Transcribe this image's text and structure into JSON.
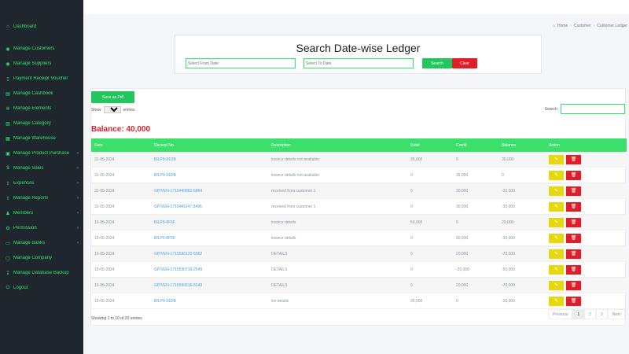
{
  "sidebar": {
    "items": [
      {
        "label": "Dashboard",
        "icon": "⌂",
        "chevron": ""
      },
      {
        "label": "Manage Customers",
        "icon": "◉",
        "chevron": ""
      },
      {
        "label": "Manage Suppliers",
        "icon": "◉",
        "chevron": ""
      },
      {
        "label": "Payment Receipt Voucher",
        "icon": "▯",
        "chevron": ""
      },
      {
        "label": "Manage Cashbook",
        "icon": "▤",
        "chevron": ""
      },
      {
        "label": "Manage Elements",
        "icon": "✲",
        "chevron": ""
      },
      {
        "label": "Manage Category",
        "icon": "▥",
        "chevron": ""
      },
      {
        "label": "Manage Warehouse",
        "icon": "▦",
        "chevron": ""
      },
      {
        "label": "Manage Product Purchase",
        "icon": "▣",
        "chevron": "‹"
      },
      {
        "label": "Manage Sales",
        "icon": "$",
        "chevron": "‹"
      },
      {
        "label": "Expences",
        "icon": "⇪",
        "chevron": "‹"
      },
      {
        "label": "Manage Reports",
        "icon": "⇪",
        "chevron": "‹"
      },
      {
        "label": "Members",
        "icon": "♟",
        "chevron": "‹"
      },
      {
        "label": "Permission",
        "icon": "⚙",
        "chevron": "‹"
      },
      {
        "label": "Manage Banks",
        "icon": "▭",
        "chevron": "‹"
      },
      {
        "label": "Manage Company",
        "icon": "▢",
        "chevron": ""
      },
      {
        "label": "Manage Database Backup",
        "icon": "↧",
        "chevron": ""
      },
      {
        "label": "Logout",
        "icon": "⏻",
        "chevron": ""
      }
    ]
  },
  "breadcrumb": {
    "home": "Home",
    "customer": "Customer",
    "current": "Customer Ledger"
  },
  "search": {
    "title": "Search Date-wise Ledger",
    "from_placeholder": "Select From Date",
    "to_placeholder": "Select To Date",
    "search_label": "Search",
    "clear_label": "Clear"
  },
  "ledger": {
    "save_pdf_label": "Save as Pdf",
    "show_label": "Show",
    "entries_value": "10",
    "entries_label": "entries",
    "search_label": "Search:",
    "balance": "Balance: 40,000",
    "columns": [
      "Date",
      "Receipt No.",
      "Description",
      "Debit",
      "Credit",
      "Balance",
      "Action"
    ],
    "rows": [
      {
        "date": "31-05-2024",
        "receipt": "BILP9-91DB",
        "desc": "invoice details not available",
        "debit": "35,000",
        "credit": "0",
        "balance": "35,000"
      },
      {
        "date": "31-05-2024",
        "receipt": "BILP9-91DB",
        "desc": "invoice details not available",
        "debit": "0",
        "credit": "35,000",
        "balance": "0"
      },
      {
        "date": "31-05-2024",
        "receipt": "GP/VEN-1716440882-6864",
        "desc": "received from customer 1",
        "debit": "0",
        "credit": "30,000",
        "balance": "-30,000"
      },
      {
        "date": "31-05-2024",
        "receipt": "GP/VEN-1716441147-3496",
        "desc": "received from customer 1",
        "debit": "0",
        "credit": "30,000",
        "balance": "-30,000"
      },
      {
        "date": "15-05-2024",
        "receipt": "BILP9-8F5F",
        "desc": "invoice details",
        "debit": "50,000",
        "credit": "0",
        "balance": "20,000"
      },
      {
        "date": "15-05-2024",
        "receipt": "BILP9-8F5F",
        "desc": "invoice details",
        "debit": "0",
        "credit": "50,000",
        "balance": "-30,000"
      },
      {
        "date": "15-05-2024",
        "receipt": "GP/VEN-1715596125-5562",
        "desc": "DETAILS",
        "debit": "0",
        "credit": "20,000",
        "balance": "-70,000"
      },
      {
        "date": "15-05-2024",
        "receipt": "GP/VEN-1715590716-2549",
        "desc": "DETAILS",
        "debit": "0",
        "credit": "-20,000",
        "balance": "-50,000"
      },
      {
        "date": "15-05-2024",
        "receipt": "GP/VEN-1715590616-5649",
        "desc": "DETAILS",
        "debit": "0",
        "credit": "20,000",
        "balance": "-70,000"
      },
      {
        "date": "15-05-2024",
        "receipt": "BILP9-91DB",
        "desc": "inv details",
        "debit": "35,000",
        "credit": "0",
        "balance": "-35,000"
      }
    ],
    "showing": "Showing 1 to 10 of 20 entries",
    "pagination": [
      "Previous",
      "1",
      "2",
      "3",
      "Next"
    ]
  },
  "icons": {
    "edit": "✎",
    "delete": "🗑"
  },
  "colors": {
    "accent": "#2ee66b",
    "danger": "#e11d2a",
    "warning": "#e6d80e",
    "sidebar_bg": "#1f262d"
  }
}
